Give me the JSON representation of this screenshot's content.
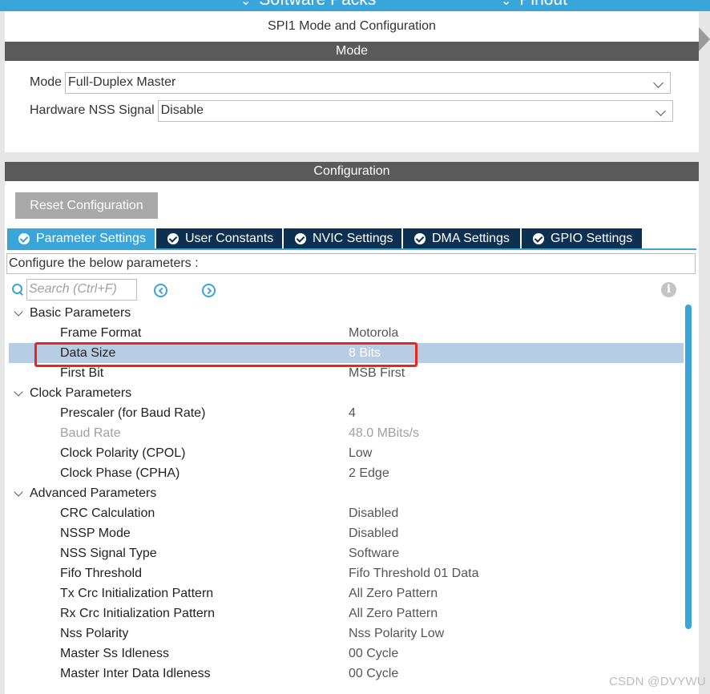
{
  "topbar": {
    "items": [
      {
        "label": "Software Packs",
        "icon": "chevron-down-icon"
      },
      {
        "label": "Pinout",
        "icon": "chevron-down-icon"
      }
    ]
  },
  "panel": {
    "title": "SPI1 Mode and Configuration"
  },
  "mode_section": {
    "header": "Mode",
    "mode_label": "Mode",
    "mode_value": "Full-Duplex Master",
    "nss_label": "Hardware NSS Signal",
    "nss_value": "Disable"
  },
  "config_section": {
    "header": "Configuration",
    "reset_label": "Reset Configuration",
    "tabs": [
      {
        "label": "Parameter Settings",
        "active": true
      },
      {
        "label": "User Constants",
        "active": false
      },
      {
        "label": "NVIC Settings",
        "active": false
      },
      {
        "label": "DMA Settings",
        "active": false
      },
      {
        "label": "GPIO Settings",
        "active": false
      }
    ],
    "description": "Configure the below parameters :",
    "search_placeholder": "Search (Ctrl+F)",
    "info_glyph": "i"
  },
  "parameters": {
    "basic": {
      "label": "Basic Parameters",
      "rows": [
        {
          "name": "Frame Format",
          "value": "Motorola"
        },
        {
          "name": "Data Size",
          "value": "8 Bits"
        },
        {
          "name": "First Bit",
          "value": "MSB First"
        }
      ]
    },
    "clock": {
      "label": "Clock Parameters",
      "rows": [
        {
          "name": "Prescaler (for Baud Rate)",
          "value": "4"
        },
        {
          "name": "Baud Rate",
          "value": "48.0 MBits/s"
        },
        {
          "name": "Clock Polarity (CPOL)",
          "value": "Low"
        },
        {
          "name": "Clock Phase (CPHA)",
          "value": "2 Edge"
        }
      ]
    },
    "advanced": {
      "label": "Advanced Parameters",
      "rows": [
        {
          "name": "CRC Calculation",
          "value": "Disabled"
        },
        {
          "name": "NSSP Mode",
          "value": "Disabled"
        },
        {
          "name": "NSS Signal Type",
          "value": "Software"
        },
        {
          "name": "Fifo Threshold",
          "value": "Fifo Threshold 01 Data"
        },
        {
          "name": "Tx Crc Initialization Pattern",
          "value": "All Zero Pattern"
        },
        {
          "name": "Rx Crc Initialization Pattern",
          "value": "All Zero Pattern"
        },
        {
          "name": "Nss Polarity",
          "value": "Nss Polarity Low"
        },
        {
          "name": "Master Ss Idleness",
          "value": "00 Cycle"
        },
        {
          "name": "Master Inter Data Idleness",
          "value": "00 Cycle"
        }
      ]
    }
  },
  "watermark": "CSDN @DVYWU",
  "colors": {
    "accent": "#3aa5d8",
    "tab_dark": "#0e3050",
    "section_header": "#5a5a5a",
    "selected_row": "#b7cde3",
    "highlight": "#e8261e"
  }
}
